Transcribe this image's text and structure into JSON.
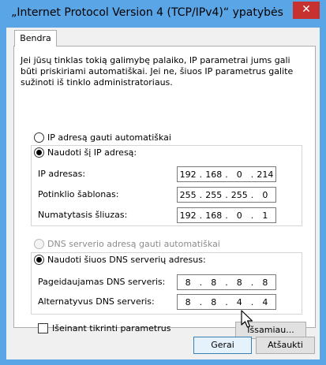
{
  "window": {
    "title": "„Internet Protocol Version 4 (TCP/IPv4)“ ypatybės",
    "close_symbol": "✕"
  },
  "tabs": [
    {
      "label": "Bendra"
    }
  ],
  "intro_text": "Jei jūsų tinklas tokią galimybę palaiko, IP parametrai jums gali būti priskiriami automatiškai. Jei ne, šiuos IP parametrus galite sužinoti iš tinklo administratoriaus.",
  "ip": {
    "auto_label": "IP adresą gauti automatiškai",
    "manual_label": "Naudoti šį IP adresą:",
    "auto_selected": false,
    "manual_selected": true,
    "fields": [
      {
        "label": "IP adresas:",
        "octets": [
          "192",
          "168",
          "0",
          "214"
        ]
      },
      {
        "label": "Potinklio šablonas:",
        "octets": [
          "255",
          "255",
          "255",
          "0"
        ]
      },
      {
        "label": "Numatytasis šliuzas:",
        "octets": [
          "192",
          "168",
          "0",
          "1"
        ]
      }
    ]
  },
  "dns": {
    "auto_label": "DNS serverio adresą gauti automatiškai",
    "manual_label": "Naudoti šiuos DNS serverių adresus:",
    "auto_selected": false,
    "manual_selected": true,
    "auto_disabled": true,
    "fields": [
      {
        "label": "Pageidaujamas DNS serveris:",
        "octets": [
          "8",
          "8",
          "8",
          "8"
        ]
      },
      {
        "label": "Alternatyvus DNS serveris:",
        "octets": [
          "8",
          "8",
          "4",
          "4"
        ]
      }
    ]
  },
  "validate": {
    "label": "Išeinant tikrinti parametrus",
    "checked": false
  },
  "buttons": {
    "advanced": "Išsamiau...",
    "ok": "Gerai",
    "cancel": "Atšaukti"
  },
  "colors": {
    "titlebar": "#5aa5e6",
    "close_button": "#c7312f",
    "dialog_background": "#f0f0f0"
  },
  "icons": {
    "close": "close-icon",
    "cursor": "mouse-pointer-icon"
  }
}
